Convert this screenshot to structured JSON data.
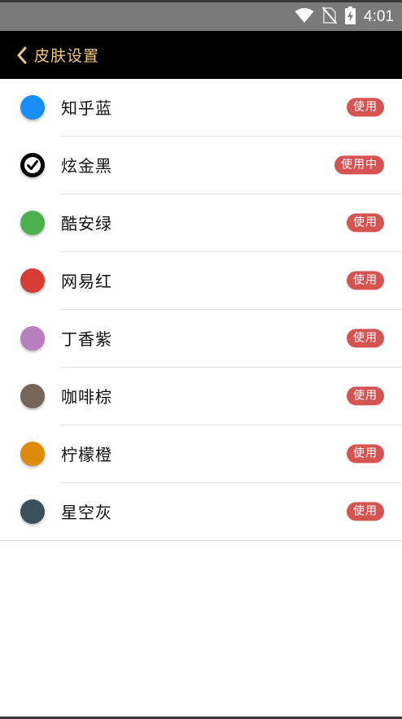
{
  "status_bar": {
    "time": "4:01",
    "icons": [
      "wifi-icon",
      "no-sim-icon",
      "battery-charging-icon"
    ]
  },
  "app_bar": {
    "title": "皮肤设置",
    "back_icon": "chevron-left-icon",
    "title_color": "#f2c878",
    "background": "#000000"
  },
  "skins": [
    {
      "name": "知乎蓝",
      "color": "#1a8ef8",
      "button": "使用",
      "active": false
    },
    {
      "name": "炫金黑",
      "color": "#000000",
      "button": "使用中",
      "active": true
    },
    {
      "name": "酷安绿",
      "color": "#4caf50",
      "button": "使用",
      "active": false
    },
    {
      "name": "网易红",
      "color": "#d63c33",
      "button": "使用",
      "active": false
    },
    {
      "name": "丁香紫",
      "color": "#b77fbe",
      "button": "使用",
      "active": false
    },
    {
      "name": "咖啡棕",
      "color": "#77655a",
      "button": "使用",
      "active": false
    },
    {
      "name": "柠檬橙",
      "color": "#e08a0a",
      "button": "使用",
      "active": false
    },
    {
      "name": "星空灰",
      "color": "#3b4f5c",
      "button": "使用",
      "active": false
    }
  ],
  "button_color": "#d55451"
}
